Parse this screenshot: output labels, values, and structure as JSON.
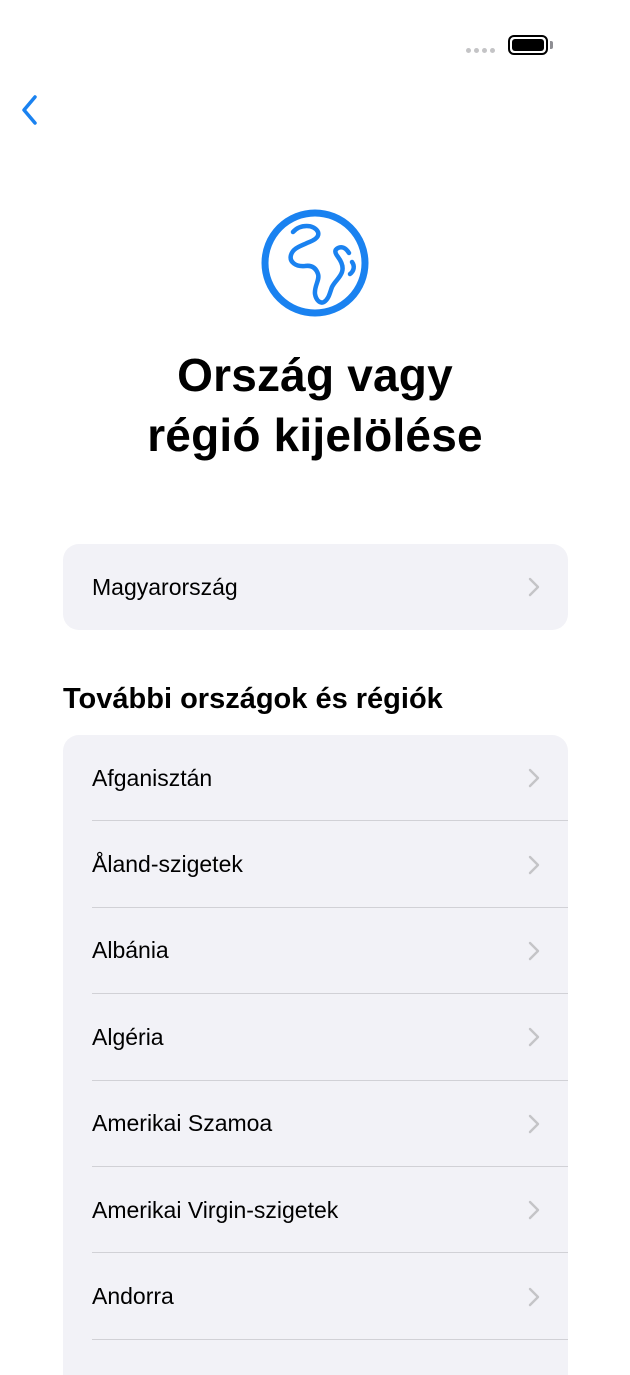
{
  "status_bar": {
    "signal_dots": 4,
    "battery_level": 1.0
  },
  "navigation": {
    "back_icon": "chevron-left-icon"
  },
  "header": {
    "icon": "globe-africa-icon",
    "title_line1": "Ország vagy",
    "title_line2": "régió kijelölése"
  },
  "current_region": {
    "label": "Magyarország"
  },
  "more_regions": {
    "heading": "További országok és régiók",
    "items": [
      {
        "label": "Afganisztán"
      },
      {
        "label": "Åland-szigetek"
      },
      {
        "label": "Albánia"
      },
      {
        "label": "Algéria"
      },
      {
        "label": "Amerikai Szamoa"
      },
      {
        "label": "Amerikai Virgin-szigetek"
      },
      {
        "label": "Andorra"
      }
    ]
  },
  "colors": {
    "accent": "#1a82f0",
    "card_background": "#f2f2f7",
    "chevron": "#c4c4c7",
    "divider": "#d1d1d6"
  }
}
